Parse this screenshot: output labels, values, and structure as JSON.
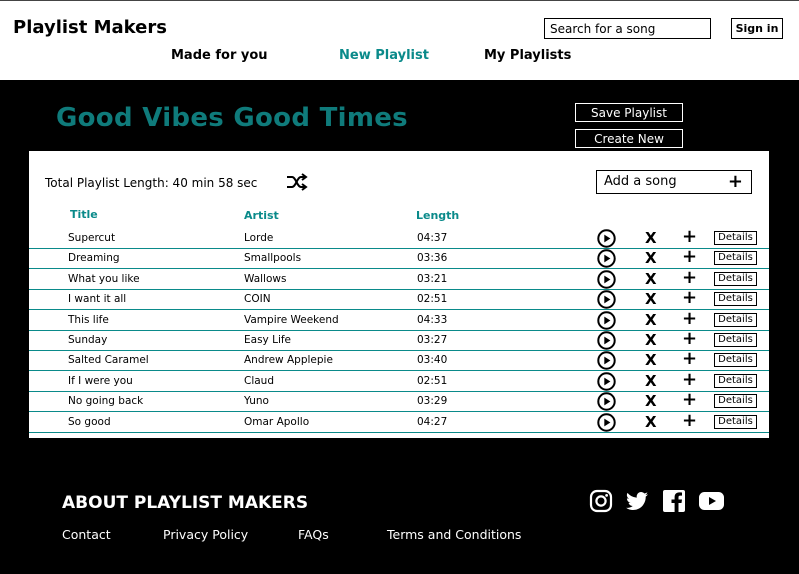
{
  "header": {
    "brand": "Playlist Makers",
    "search_placeholder": "Search for a song",
    "signin": "Sign in",
    "nav": [
      "Made for you",
      "New Playlist",
      "My Playlists"
    ]
  },
  "playlist": {
    "title": "Good Vibes Good Times",
    "save_label": "Save Playlist",
    "create_label": "Create New",
    "total_length": "Total Playlist Length: 40 min 58 sec",
    "add_song_label": "Add a song",
    "columns": {
      "title": "Title",
      "artist": "Artist",
      "length": "Length"
    },
    "details_label": "Details",
    "remove_glyph": "X",
    "add_glyph": "+",
    "songs": [
      {
        "title": "Supercut",
        "artist": "Lorde",
        "length": "04:37"
      },
      {
        "title": "Dreaming",
        "artist": "Smallpools",
        "length": "03:36"
      },
      {
        "title": "What you like",
        "artist": "Wallows",
        "length": "03:21"
      },
      {
        "title": "I want it all",
        "artist": "COIN",
        "length": "02:51"
      },
      {
        "title": "This life",
        "artist": "Vampire Weekend",
        "length": "04:33"
      },
      {
        "title": "Sunday",
        "artist": "Easy Life",
        "length": "03:27"
      },
      {
        "title": "Salted Caramel",
        "artist": "Andrew Applepie",
        "length": "03:40"
      },
      {
        "title": "If I were you",
        "artist": "Claud",
        "length": "02:51"
      },
      {
        "title": "No going back",
        "artist": "Yuno",
        "length": "03:29"
      },
      {
        "title": "So good",
        "artist": "Omar Apollo",
        "length": "04:27"
      }
    ]
  },
  "footer": {
    "about": "ABOUT PLAYLIST MAKERS",
    "links": [
      "Contact",
      "Privacy Policy",
      "FAQs",
      "Terms and Conditions"
    ],
    "social_icons": [
      "instagram-icon",
      "twitter-icon",
      "facebook-icon",
      "youtube-icon"
    ]
  },
  "colors": {
    "accent": "#0a8a8a",
    "title": "#0f7b7b",
    "background": "#000000"
  }
}
